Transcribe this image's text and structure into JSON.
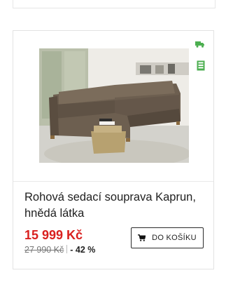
{
  "product": {
    "name": "Rohová sedací souprava Kaprun, hnědá látka",
    "price": "15 999 Kč",
    "old_price": "27 990 Kč",
    "discount": "- 42 %",
    "cart_button_label": "DO KOŠÍKU",
    "icons": [
      "truck-icon",
      "store-icon",
      "cart-icon"
    ],
    "colors": {
      "price": "#d9201f",
      "badge_icon": "#4caf50",
      "text": "#1f1f1f"
    }
  }
}
